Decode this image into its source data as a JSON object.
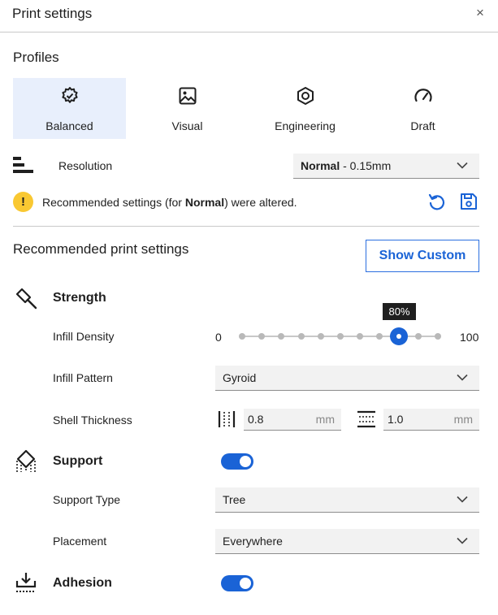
{
  "window": {
    "title": "Print settings",
    "close_glyph": "×",
    "close_icon": "close-icon"
  },
  "profiles": {
    "heading": "Profiles",
    "items": [
      {
        "label": "Balanced",
        "icon": "balanced-gear-icon",
        "selected": true
      },
      {
        "label": "Visual",
        "icon": "image-icon",
        "selected": false
      },
      {
        "label": "Engineering",
        "icon": "hex-nut-icon",
        "selected": false
      },
      {
        "label": "Draft",
        "icon": "speedometer-icon",
        "selected": false
      }
    ]
  },
  "resolution": {
    "label": "Resolution",
    "icon": "layer-height-icon",
    "selected_bold": "Normal",
    "selected_rest": " - 0.15mm"
  },
  "warning": {
    "text_before": "Recommended settings (for ",
    "text_bold": "Normal",
    "text_after": ") were altered.",
    "icon": "warning-icon",
    "reset_icon": "reset-icon",
    "save_icon": "save-icon"
  },
  "recommended": {
    "heading": "Recommended print settings",
    "show_custom_label": "Show Custom"
  },
  "strength": {
    "title": "Strength",
    "icon": "hammer-icon",
    "infill_density": {
      "label": "Infill Density",
      "min_label": "0",
      "max_label": "100",
      "value_label": "80%",
      "value": 80
    },
    "infill_pattern": {
      "label": "Infill Pattern",
      "value": "Gyroid"
    },
    "shell_thickness": {
      "label": "Shell Thickness",
      "wall_value": "0.8",
      "wall_unit": "mm",
      "wall_icon": "wall-thickness-icon",
      "topbottom_value": "1.0",
      "topbottom_unit": "mm",
      "topbottom_icon": "top-bottom-thickness-icon"
    }
  },
  "support": {
    "title": "Support",
    "icon": "support-icon",
    "enabled": true,
    "support_type": {
      "label": "Support Type",
      "value": "Tree"
    },
    "placement": {
      "label": "Placement",
      "value": "Everywhere"
    }
  },
  "adhesion": {
    "title": "Adhesion",
    "icon": "adhesion-icon",
    "enabled": true
  },
  "colors": {
    "accent": "#1a63d6",
    "selected_bg": "#e8effc",
    "warning": "#f9c832"
  }
}
